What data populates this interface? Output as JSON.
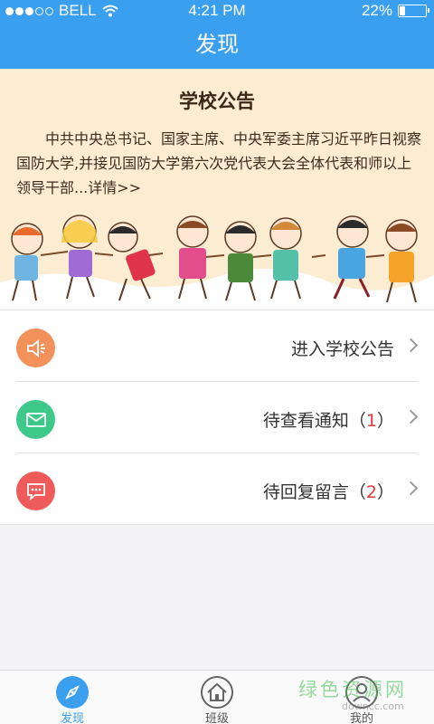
{
  "status_bar": {
    "carrier": "BELL",
    "time": "4:21 PM",
    "battery": "22%",
    "battery_level": 0.22
  },
  "nav": {
    "title": "发现"
  },
  "announcement": {
    "title": "学校公告",
    "body": "中共中央总书记、国家主席、中央军委主席习近平昨日视察国防大学,并接见国防大学第六次党代表大会全体代表和师以上领导干部...详情>>"
  },
  "list": [
    {
      "label": "进入学校公告",
      "count": "",
      "icon": "speaker-icon",
      "color": "#f3915a"
    },
    {
      "label": "待查看通知（",
      "count": "1",
      "suffix": "）",
      "icon": "mail-icon",
      "color": "#3ec98a"
    },
    {
      "label": "待回复留言（",
      "count": "2",
      "suffix": "）",
      "icon": "message-icon",
      "color": "#ef5b5b"
    }
  ],
  "tabs": [
    {
      "label": "发现",
      "icon": "compass-icon",
      "active": true
    },
    {
      "label": "班级",
      "icon": "home-icon",
      "active": false
    },
    {
      "label": "我的",
      "icon": "profile-icon",
      "active": false
    }
  ],
  "watermark": {
    "title": "绿色资源网",
    "url": "downcc.com"
  },
  "colors": {
    "primary": "#3b9ff0",
    "banner_bg": "#fcecd1",
    "highlight": "#e53935"
  }
}
